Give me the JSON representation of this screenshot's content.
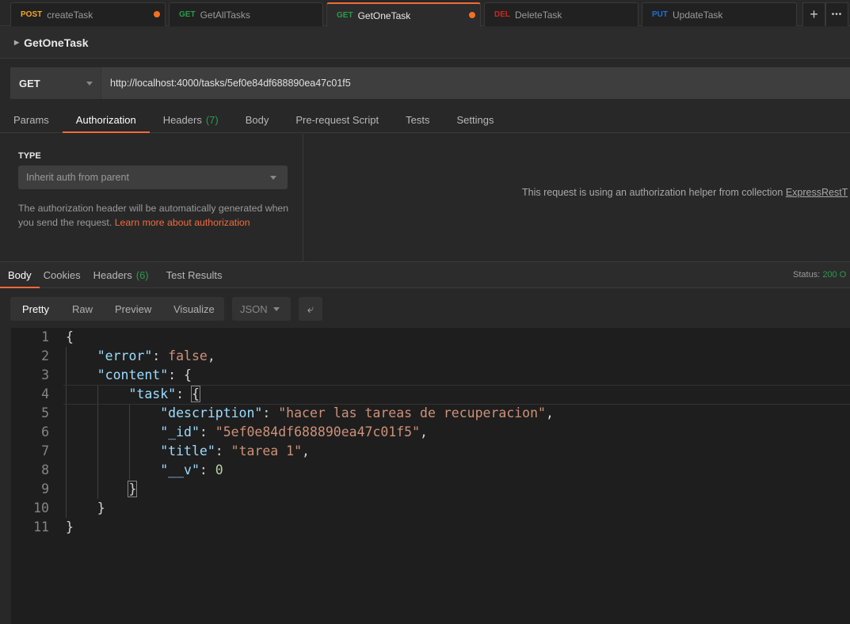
{
  "tabs": [
    {
      "method": "POST",
      "name": "createTask",
      "method_color": "#f5a623",
      "unsaved": true
    },
    {
      "method": "GET",
      "name": "GetAllTasks",
      "method_color": "#2a9c4a",
      "unsaved": false
    },
    {
      "method": "GET",
      "name": "GetOneTask",
      "method_color": "#2a9c4a",
      "unsaved": true,
      "active": true
    },
    {
      "method": "DEL",
      "name": "DeleteTask",
      "method_color": "#d0261c",
      "unsaved": false
    },
    {
      "method": "PUT",
      "name": "UpdateTask",
      "method_color": "#1a73d4",
      "unsaved": false
    }
  ],
  "tab_actions": {
    "new": "+",
    "more": "•••"
  },
  "request": {
    "title": "GetOneTask",
    "method": "GET",
    "url": "http://localhost:4000/tasks/5ef0e84df688890ea47c01f5"
  },
  "request_tabs": [
    {
      "label": "Params"
    },
    {
      "label": "Authorization",
      "active": true
    },
    {
      "label": "Headers",
      "count": "(7)"
    },
    {
      "label": "Body"
    },
    {
      "label": "Pre-request Script"
    },
    {
      "label": "Tests"
    },
    {
      "label": "Settings"
    }
  ],
  "auth": {
    "type_label": "TYPE",
    "type_value": "Inherit auth from parent",
    "help": "The authorization header will be automatically generated when you send the request.",
    "learn_more": "Learn more about authorization",
    "helper_text": "This request is using an authorization helper from collection",
    "collection": "ExpressRestT"
  },
  "response_tabs": [
    {
      "label": "Body",
      "active": true
    },
    {
      "label": "Cookies"
    },
    {
      "label": "Headers",
      "count": "(6)"
    },
    {
      "label": "Test Results"
    }
  ],
  "status": {
    "label": "Status:",
    "value": "200 O"
  },
  "view_modes": [
    "Pretty",
    "Raw",
    "Preview",
    "Visualize"
  ],
  "format": "JSON",
  "accent": "#f26b3a",
  "code_lines": [
    "1",
    "2",
    "3",
    "4",
    "5",
    "6",
    "7",
    "8",
    "9",
    "10",
    "11"
  ],
  "json": {
    "error_key": "\"error\"",
    "error_val": "false",
    "content_key": "\"content\"",
    "task_key": "\"task\"",
    "desc_key": "\"description\"",
    "desc_val": "\"hacer las tareas de recuperacion\"",
    "id_key": "\"_id\"",
    "id_val": "\"5ef0e84df688890ea47c01f5\"",
    "title_key": "\"title\"",
    "title_val": "\"tarea 1\"",
    "v_key": "\"__v\"",
    "v_val": "0"
  }
}
